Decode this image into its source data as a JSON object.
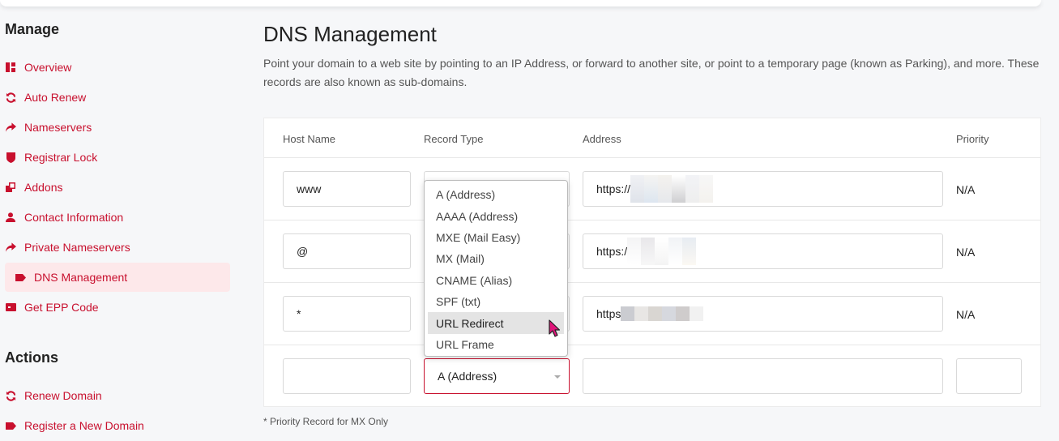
{
  "sidebar": {
    "manage_title": "Manage",
    "manage_items": [
      {
        "label": "Overview",
        "icon": "overview-icon"
      },
      {
        "label": "Auto Renew",
        "icon": "sync-icon"
      },
      {
        "label": "Nameservers",
        "icon": "forward-arrow-icon"
      },
      {
        "label": "Registrar Lock",
        "icon": "shield-icon"
      },
      {
        "label": "Addons",
        "icon": "addons-icon"
      },
      {
        "label": "Contact Information",
        "icon": "user-icon"
      },
      {
        "label": "Private Nameservers",
        "icon": "forward-arrow-icon"
      },
      {
        "label": "DNS Management",
        "icon": "tag-icon",
        "active": true
      },
      {
        "label": "Get EPP Code",
        "icon": "code-card-icon"
      }
    ],
    "actions_title": "Actions",
    "action_items": [
      {
        "label": "Renew Domain",
        "icon": "sync-icon"
      },
      {
        "label": "Register a New Domain",
        "icon": "tag-icon"
      }
    ]
  },
  "main": {
    "title": "DNS Management",
    "description": "Point your domain to a web site by pointing to an IP Address, or forward to another site, or point to a temporary page (known as Parking), and more. These records are also known as sub-domains.",
    "table": {
      "headers": {
        "host": "Host Name",
        "type": "Record Type",
        "address": "Address",
        "priority": "Priority"
      },
      "rows": [
        {
          "host": "www",
          "address": "https://",
          "priority": "N/A"
        },
        {
          "host": "@",
          "address": "https:/",
          "priority": "N/A"
        },
        {
          "host": "*",
          "address": "https",
          "priority": "N/A"
        }
      ],
      "new_row": {
        "host": "",
        "type": "A (Address)",
        "address": "",
        "priority": ""
      }
    },
    "dropdown": {
      "options": [
        "A (Address)",
        "AAAA (Address)",
        "MXE (Mail Easy)",
        "MX (Mail)",
        "CNAME (Alias)",
        "SPF (txt)",
        "URL Redirect",
        "URL Frame"
      ],
      "highlighted": "URL Redirect"
    },
    "footnote": "* Priority Record for MX Only"
  },
  "colors": {
    "accent": "#c8102e",
    "active_bg": "#fde8ea",
    "cursor": "#e0157a"
  }
}
